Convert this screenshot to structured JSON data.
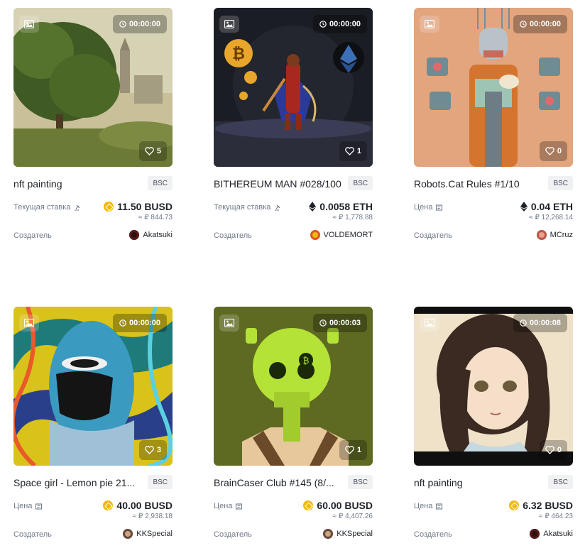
{
  "cards": [
    {
      "title": "nft painting",
      "chain": "BSC",
      "timer": "00:00:00",
      "likes": "5",
      "price_label": "Текущая ставка",
      "price": "11.50 BUSD",
      "currency_icon": "busd-coin-icon",
      "fiat": "≈ ₽ 844.73",
      "creator_label": "Создатель",
      "creator": "Akatsuki",
      "art": "landscape"
    },
    {
      "title": "BITHEREUM MAN #028/100",
      "chain": "BSC",
      "timer": "00:00:00",
      "likes": "1",
      "price_label": "Текущая ставка",
      "price": "0.0058 ETH",
      "currency_icon": "eth-icon",
      "fiat": "≈ ₽ 1,778.88",
      "creator_label": "Создатель",
      "creator": "VOLDEMORT",
      "art": "bithereum"
    },
    {
      "title": "Robots.Cat Rules #1/10",
      "chain": "BSC",
      "timer": "00:00:00",
      "likes": "0",
      "price_label": "Цена",
      "price": "0.04 ETH",
      "currency_icon": "eth-icon",
      "fiat": "≈ ₽ 12,268.14",
      "creator_label": "Создатель",
      "creator": "MCruz",
      "art": "robot"
    },
    {
      "title": "Space girl - Lemon pie 21...",
      "chain": "BSC",
      "timer": "00:00:00",
      "likes": "3",
      "price_label": "Цена",
      "price": "40.00 BUSD",
      "currency_icon": "busd-coin-icon",
      "fiat": "≈ ₽ 2,938.18",
      "creator_label": "Создатель",
      "creator": "KKSpecial",
      "art": "spacegirl"
    },
    {
      "title": "BrainCaser Club #145 (8/...",
      "chain": "BSC",
      "timer": "00:00:03",
      "likes": "1",
      "price_label": "Цена",
      "price": "60.00 BUSD",
      "currency_icon": "busd-coin-icon",
      "fiat": "≈ ₽ 4,407.26",
      "creator_label": "Создатель",
      "creator": "KKSpecial",
      "art": "skull"
    },
    {
      "title": "nft painting",
      "chain": "BSC",
      "timer": "00:00:08",
      "likes": "0",
      "price_label": "Цена",
      "price": "6.32 BUSD",
      "currency_icon": "busd-coin-icon",
      "fiat": "≈ ₽ 464.23",
      "creator_label": "Создатель",
      "creator": "Akatsuki",
      "art": "animegirl"
    }
  ],
  "colors": {
    "busd": "#f0b90b",
    "text": "#1e2329",
    "muted": "#707a8a"
  }
}
